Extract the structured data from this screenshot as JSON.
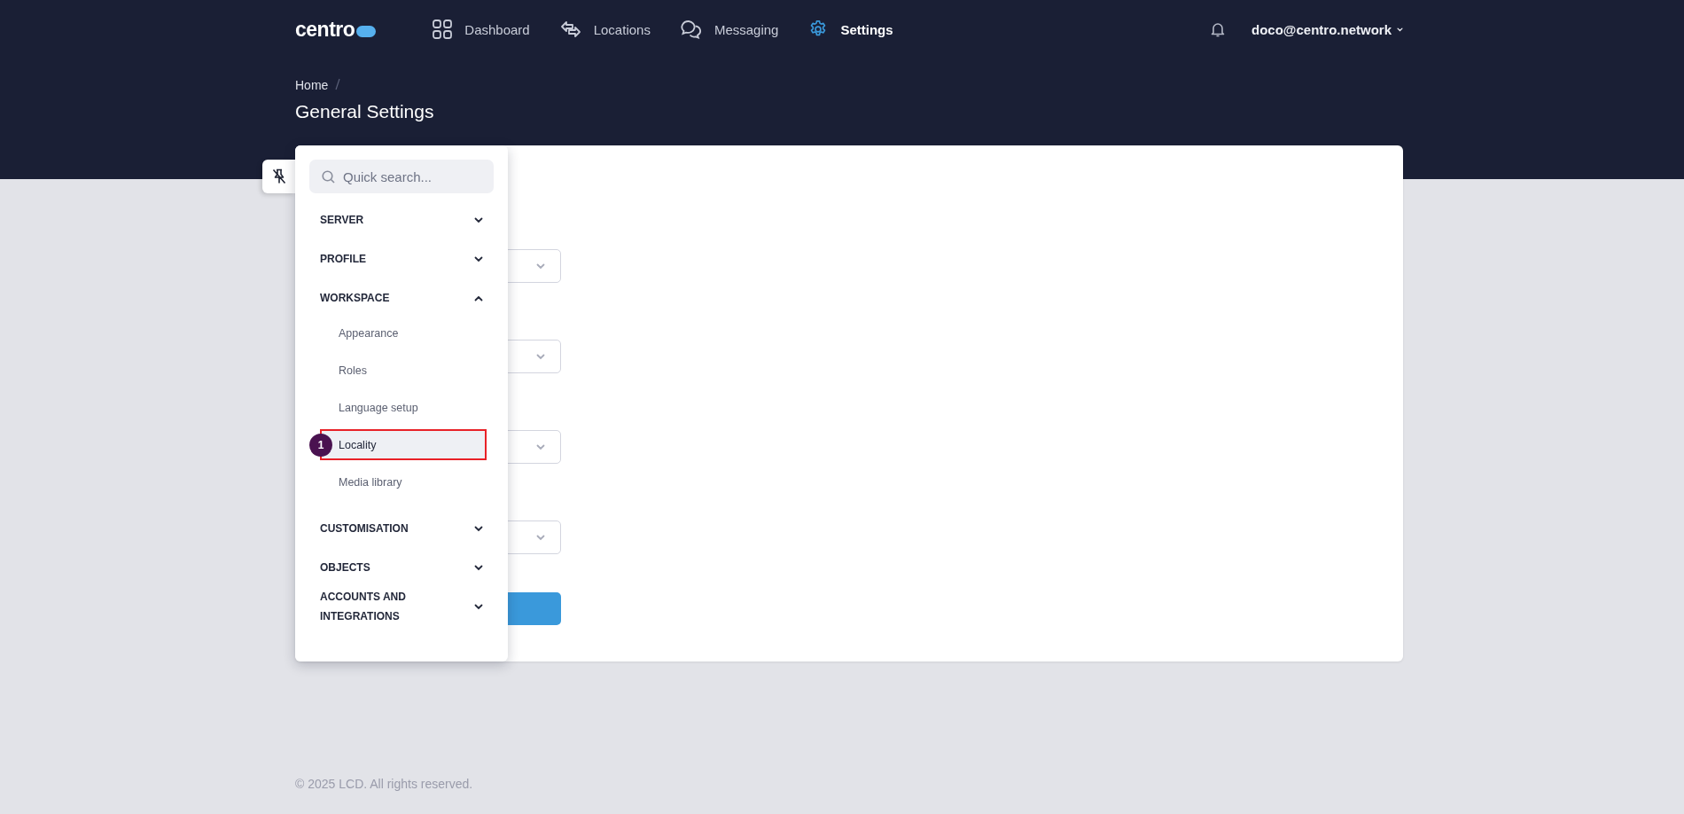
{
  "brand": {
    "logo": "centro"
  },
  "nav": [
    {
      "label": "Dashboard",
      "kind": "grid",
      "selected": false
    },
    {
      "label": "Locations",
      "kind": "arrows",
      "selected": false
    },
    {
      "label": "Messaging",
      "kind": "chat",
      "selected": false
    },
    {
      "label": "Settings",
      "kind": "gear",
      "selected": true
    }
  ],
  "user": {
    "email": "doco@centro.network"
  },
  "breadcrumb": [
    "Home"
  ],
  "page_title": "General Settings",
  "settings_menu": {
    "search": {
      "placeholder": "Quick search..."
    },
    "sections": [
      {
        "label": "SERVER",
        "expanded": false
      },
      {
        "label": "PROFILE",
        "expanded": false
      },
      {
        "label": "WORKSPACE",
        "expanded": true,
        "children": [
          {
            "label": "Appearance",
            "selected": false
          },
          {
            "label": "Roles",
            "selected": false
          },
          {
            "label": "Language setup",
            "selected": false
          },
          {
            "label": "Locality",
            "selected": true,
            "marker": "1"
          },
          {
            "label": "Media library",
            "selected": false
          }
        ]
      },
      {
        "label": "CUSTOMISATION",
        "expanded": false
      },
      {
        "label": "OBJECTS",
        "expanded": false
      },
      {
        "label": "ACCOUNTS AND INTEGRATIONS",
        "expanded": false
      }
    ]
  },
  "form": {
    "controls": [
      {
        "kind": "select"
      },
      {
        "kind": "select"
      },
      {
        "kind": "select"
      },
      {
        "kind": "select"
      },
      {
        "kind": "button"
      }
    ]
  },
  "footer": "© 2025 LCD. All rights reserved."
}
